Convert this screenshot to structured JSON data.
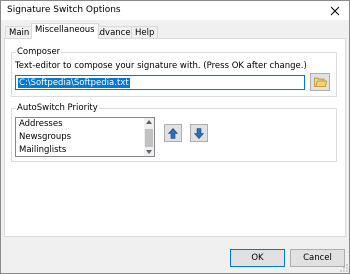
{
  "window": {
    "title": "Signature Switch Options"
  },
  "tabs": [
    {
      "label": "Main"
    },
    {
      "label": "Miscellaneous"
    },
    {
      "label": "Advanced"
    },
    {
      "label": "Help"
    }
  ],
  "composer": {
    "legend": "Composer",
    "description": "Text-editor to compose your signature with. (Press OK after change.)",
    "path_value": "C:\\Softpedia\\Softpedia.txt",
    "browse_icon": "folder-icon"
  },
  "autoswitch": {
    "legend": "AutoSwitch Priority",
    "items": [
      "Addresses",
      "Newsgroups",
      "Mailinglists"
    ],
    "move_up_icon": "up-arrow-icon",
    "move_down_icon": "down-arrow-icon"
  },
  "buttons": {
    "ok": "OK",
    "cancel": "Cancel"
  },
  "colors": {
    "accent": "#0078d7",
    "arrow_blue": "#2a6fb8"
  }
}
